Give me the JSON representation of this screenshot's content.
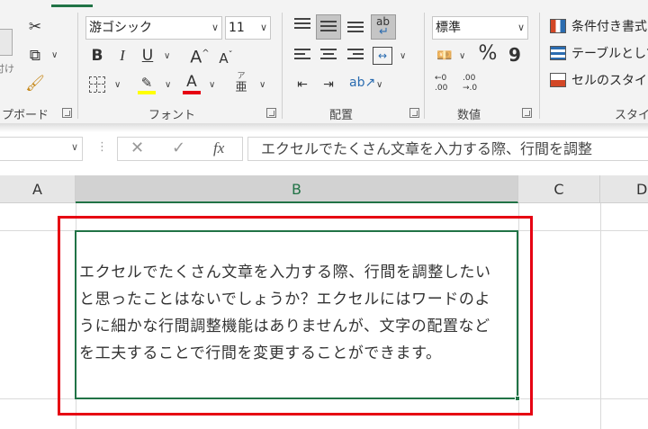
{
  "ribbon": {
    "clipboard": {
      "paste_label": "付け",
      "group_label": "プボード"
    },
    "font": {
      "font_name": "游ゴシック",
      "font_size": "11",
      "bold": "B",
      "italic": "I",
      "underline": "U",
      "grow": "A",
      "shrink": "A",
      "font_color_letter": "A",
      "phonetic_top": "ア",
      "phonetic_bottom": "亜",
      "group_label": "フォント"
    },
    "alignment": {
      "wrap_text_label": "ab",
      "group_label": "配置"
    },
    "number": {
      "format_value": "標準",
      "percent": "%",
      "comma": "9",
      "inc_decimal_top": "←0",
      "inc_decimal_bottom": ".00",
      "dec_decimal_top": ".00",
      "dec_decimal_bottom": "→.0",
      "group_label": "数値"
    },
    "styles": {
      "conditional_formatting": "条件付き書式",
      "format_as_table": "テーブルとして書",
      "cell_styles": "セルのスタイル",
      "group_label": "スタイル"
    }
  },
  "formula_bar": {
    "fx": "fx",
    "content": "エクセルでたくさん文章を入力する際、行間を調整"
  },
  "columns": [
    "A",
    "B",
    "C",
    "D"
  ],
  "cell": {
    "address_col": "B",
    "lines": [
      "エクセルでたくさん文章を入力する際、行間を調整したい",
      "と思ったことはないでしょうか？エクセルにはワードのよ",
      "うに細かな行間調整機能はありませんが、文字の配置など",
      "を工夫することで行間を変更することができます。"
    ]
  },
  "colors": {
    "accent": "#217346",
    "highlight_box": "#e60012",
    "highlight_fill": "#ffff00",
    "font_color_bar": "#e60012"
  }
}
